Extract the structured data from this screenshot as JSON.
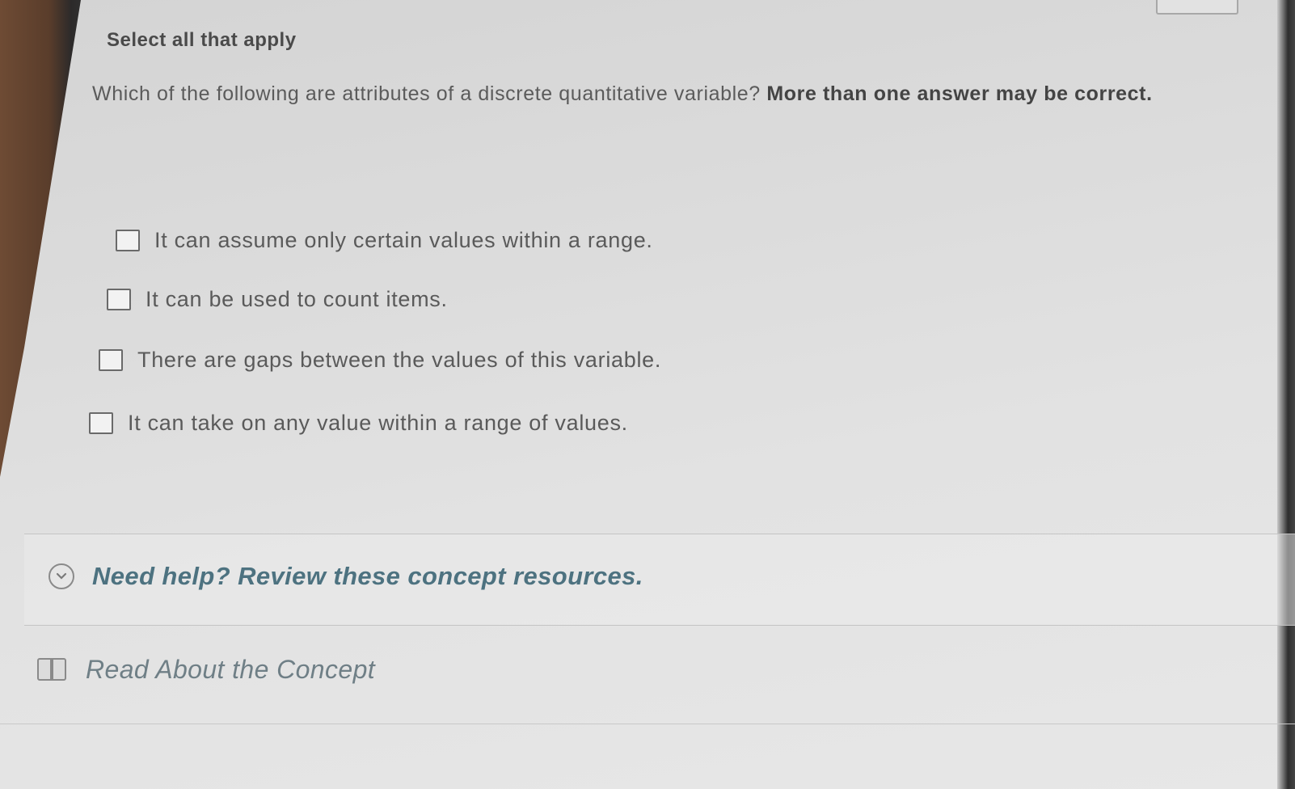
{
  "header": {
    "instruction": "Select all that apply"
  },
  "question": {
    "text": "Which of the following are attributes of a discrete quantitative variable?",
    "emphasis": "More than one answer may be correct."
  },
  "options": [
    {
      "label": "It can assume only certain values within a range.",
      "checked": false
    },
    {
      "label": "It can be used to count items.",
      "checked": false
    },
    {
      "label": "There are gaps between the values of this variable.",
      "checked": false
    },
    {
      "label": "It can take on any value within a range of values.",
      "checked": false
    }
  ],
  "help": {
    "toggle_label": "Need help? Review these concept resources.",
    "toggle_icon": "chevron-down-circle-icon",
    "resources": [
      {
        "label": "Read About the Concept",
        "icon": "book-icon"
      }
    ]
  },
  "colors": {
    "help_text": "#4d7280",
    "resource_text": "#6f7f86",
    "body_text": "#5a5a5a"
  }
}
